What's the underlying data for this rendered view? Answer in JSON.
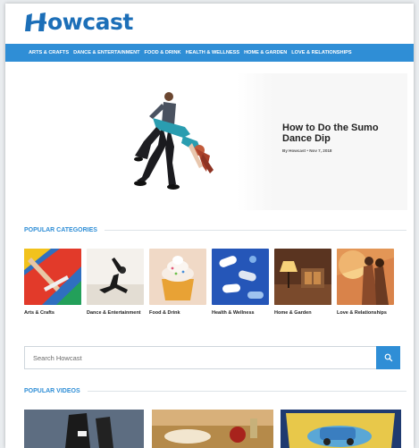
{
  "brand": {
    "logo_text": "Howcast",
    "logo_rest": "owcast",
    "color": "#1c6fb8",
    "nav_color": "#2f8ed6"
  },
  "nav": {
    "items": [
      "ARTS & CRAFTS",
      "DANCE & ENTERTAINMENT",
      "FOOD & DRINK",
      "HEALTH & WELLNESS",
      "HOME & GARDEN",
      "LOVE & RELATIONSHIPS"
    ]
  },
  "hero": {
    "title": "How to Do the Sumo Dance Dip",
    "meta": "By Howcast • Nov 7, 2018"
  },
  "popular_categories": {
    "heading": "POPULAR CATEGORIES",
    "items": [
      {
        "label": "Arts & Crafts"
      },
      {
        "label": "Dance & Entertainment"
      },
      {
        "label": "Food & Drink"
      },
      {
        "label": "Health & Wellness"
      },
      {
        "label": "Home & Garden"
      },
      {
        "label": "Love & Relationships"
      }
    ]
  },
  "search": {
    "placeholder": "Search Howcast",
    "button_icon": "search-icon"
  },
  "popular_videos": {
    "heading": "POPULAR VIDEOS"
  }
}
